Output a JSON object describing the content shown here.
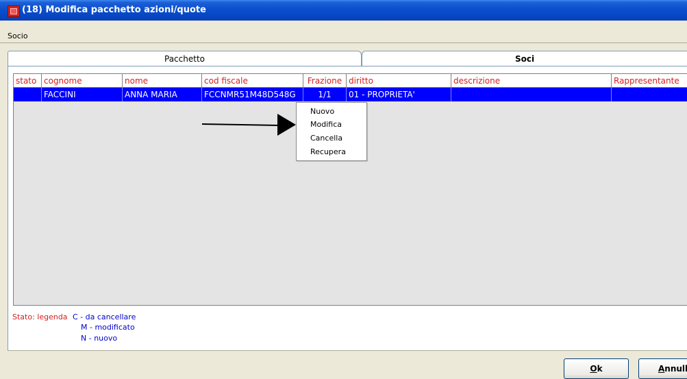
{
  "window": {
    "title": "(18) Modifica pacchetto azioni/quote",
    "icon": "app-icon"
  },
  "menu": {
    "items": [
      "Socio"
    ]
  },
  "tabs": [
    {
      "label": "Pacchetto",
      "active": false
    },
    {
      "label": "Soci",
      "active": true
    }
  ],
  "grid": {
    "columns": [
      "stato",
      "cognome",
      "nome",
      "cod fiscale",
      "Frazione",
      "diritto",
      "descrizione",
      "Rappresentante"
    ],
    "rows": [
      {
        "stato": "",
        "cognome": "FACCINI",
        "nome": "ANNA MARIA",
        "cod_fiscale": "FCCNMR51M48D548G",
        "frazione": "1/1",
        "diritto": "01 - PROPRIETA'",
        "descrizione": "",
        "rappresentante": ""
      }
    ],
    "selected_row_color": "#0000ff",
    "header_text_color": "#d42020"
  },
  "context_menu": {
    "items": [
      "Nuovo",
      "Modifica",
      "Cancella",
      "Recupera"
    ]
  },
  "legend": {
    "label": "Stato: legenda",
    "entries": [
      "C - da cancellare",
      "M - modificato",
      "N - nuovo"
    ]
  },
  "buttons": {
    "ok_hotkey": "O",
    "ok_rest": "k",
    "annulla_hotkey": "A",
    "annulla_rest": "nnull"
  }
}
